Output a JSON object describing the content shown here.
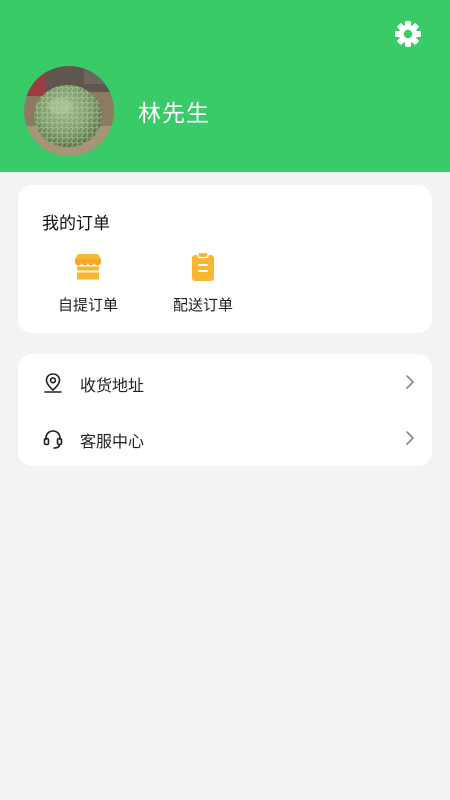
{
  "profile": {
    "name": "林先生",
    "avatar_icon": "avatar-melon-photo"
  },
  "header": {
    "background_color": "#39cb68",
    "settings_icon": "gear-icon"
  },
  "orders": {
    "title": "我的订单",
    "items": [
      {
        "label": "自提订单",
        "icon": "store-icon",
        "color": "#f7b731"
      },
      {
        "label": "配送订单",
        "icon": "clipboard-icon",
        "color": "#f7b731"
      }
    ]
  },
  "menu": {
    "items": [
      {
        "label": "收货地址",
        "icon": "location-pin-icon"
      },
      {
        "label": "客服中心",
        "icon": "headset-icon"
      }
    ]
  }
}
